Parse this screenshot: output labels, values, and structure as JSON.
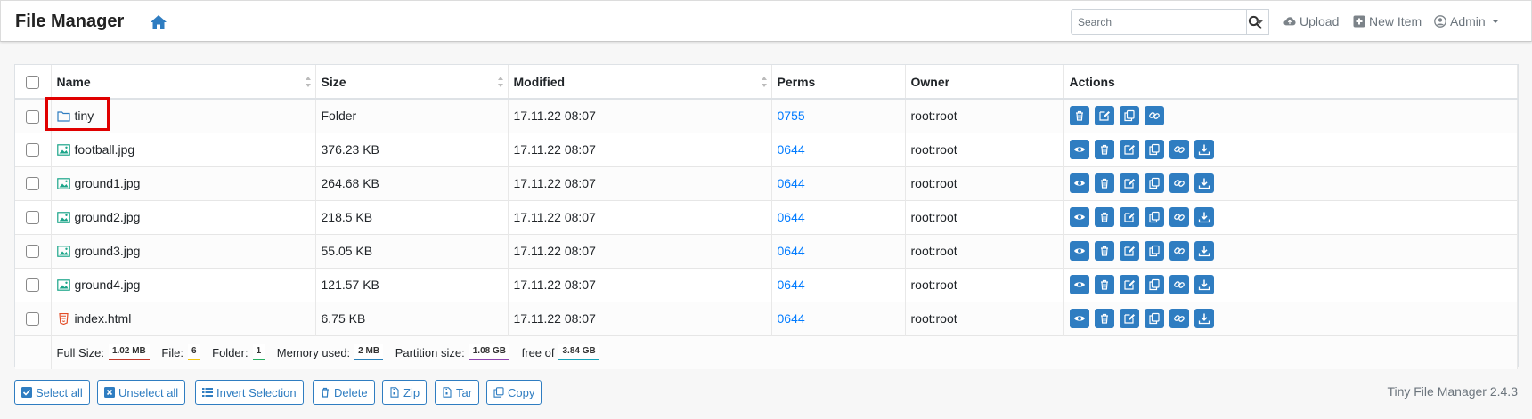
{
  "app": {
    "title": "File Manager",
    "version": "Tiny File Manager 2.4.3",
    "accent": "#2f7dc1",
    "highlight_color": "#e00000"
  },
  "nav": {
    "search_placeholder": "Search",
    "upload": "Upload",
    "new_item": "New Item",
    "admin": "Admin"
  },
  "table": {
    "headers": {
      "name": "Name",
      "size": "Size",
      "modified": "Modified",
      "perms": "Perms",
      "owner": "Owner",
      "actions": "Actions"
    },
    "rows": [
      {
        "name": "tiny",
        "type": "folder",
        "size": "Folder",
        "modified": "17.11.22 08:07",
        "perms": "0755",
        "owner": "root:root"
      },
      {
        "name": "football.jpg",
        "type": "image",
        "size": "376.23 KB",
        "modified": "17.11.22 08:07",
        "perms": "0644",
        "owner": "root:root"
      },
      {
        "name": "ground1.jpg",
        "type": "image",
        "size": "264.68 KB",
        "modified": "17.11.22 08:07",
        "perms": "0644",
        "owner": "root:root"
      },
      {
        "name": "ground2.jpg",
        "type": "image",
        "size": "218.5 KB",
        "modified": "17.11.22 08:07",
        "perms": "0644",
        "owner": "root:root"
      },
      {
        "name": "ground3.jpg",
        "type": "image",
        "size": "55.05 KB",
        "modified": "17.11.22 08:07",
        "perms": "0644",
        "owner": "root:root"
      },
      {
        "name": "ground4.jpg",
        "type": "image",
        "size": "121.57 KB",
        "modified": "17.11.22 08:07",
        "perms": "0644",
        "owner": "root:root"
      },
      {
        "name": "index.html",
        "type": "html",
        "size": "6.75 KB",
        "modified": "17.11.22 08:07",
        "perms": "0644",
        "owner": "root:root"
      }
    ]
  },
  "footer_stats": {
    "full_size_label": "Full Size:",
    "full_size": "1.02 MB",
    "file_label": "File:",
    "file": "6",
    "folder_label": "Folder:",
    "folder": "1",
    "memory_label": "Memory used:",
    "memory": "2 MB",
    "partition_label": "Partition size:",
    "partition": "1.08 GB",
    "free_label": "free of",
    "free": "3.84 GB"
  },
  "buttons": {
    "select_all": "Select all",
    "unselect_all": "Unselect all",
    "invert": "Invert Selection",
    "delete": "Delete",
    "zip": "Zip",
    "tar": "Tar",
    "copy": "Copy"
  }
}
